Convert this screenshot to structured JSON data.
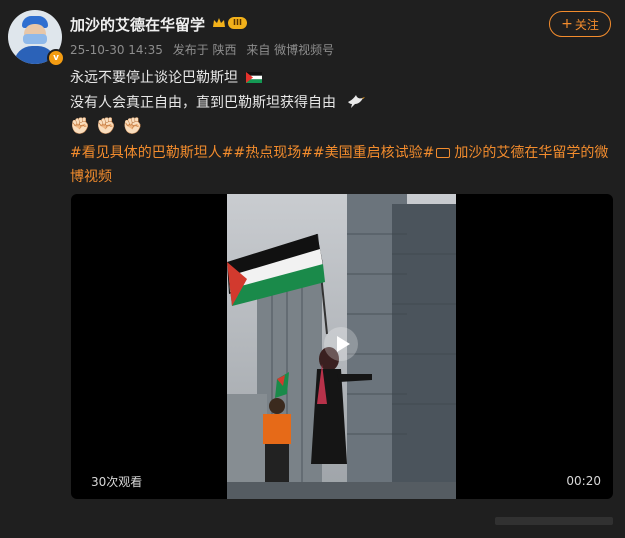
{
  "post": {
    "username": "加沙的艾德在华留学",
    "level": "III",
    "verified_mark": "v",
    "meta": {
      "date": "25-10-30 14:35",
      "published": "发布于 陕西",
      "source": "来自 微博视频号"
    },
    "follow": {
      "plus": "+",
      "label": "关注"
    },
    "lines": [
      "永远不要停止谈论巴勒斯坦",
      "没有人会真正自由，直到巴勒斯坦获得自由"
    ],
    "emoji_fists": [
      "✊🏻",
      "✊🏻",
      "✊🏻"
    ],
    "tags": {
      "text1": "#看见具体的巴勒斯坦人##热点现场##美国重启核试验#",
      "text2": "加沙的艾德在华留学的微博视频"
    },
    "video": {
      "views": "30次观看",
      "duration": "00:20"
    }
  },
  "icons": [
    "avatar",
    "verified-badge-icon",
    "crown-icon",
    "palestine-flag-icon",
    "dove-icon",
    "fist-emoji",
    "video-link-icon",
    "play-icon"
  ],
  "colors": {
    "accent": "#f38c2d",
    "background": "#1f1f1f",
    "secondary_text": "#8d8d8d"
  }
}
